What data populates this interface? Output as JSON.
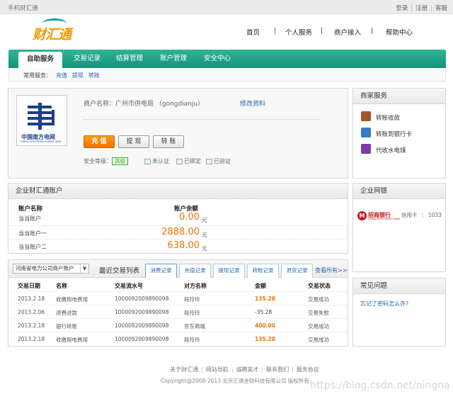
{
  "topbar": {
    "site_name": "手机财汇通",
    "links": [
      "登录",
      "注册",
      "客服"
    ]
  },
  "logo": {
    "text": "财汇通"
  },
  "main_nav": [
    "首页",
    "个人服务",
    "商户接入",
    "帮助中心"
  ],
  "tabs": [
    "自助服务",
    "交易记录",
    "结算管理",
    "账户管理",
    "安全中心"
  ],
  "subnav": {
    "label": "常用服务：",
    "links": [
      "充值",
      "提现",
      "转账"
    ]
  },
  "merchant": {
    "logo_cn": "中国南方电网",
    "logo_en": "CHINA SOUTHERN POWER GRID",
    "info": "商户名称：广州市供电局  （gongdianju）",
    "edit_link": "修改资料",
    "buttons": [
      "充 值",
      "提 现",
      "转 账"
    ],
    "security_label": "安全等级：",
    "security_level": "高级",
    "cert_status": "未认证",
    "bind_status": "已绑定",
    "verify_status": "已验证"
  },
  "accounts": {
    "title": "企业财汇通账户",
    "col_name": "账户名称",
    "col_balance": "账户余额",
    "rows": [
      {
        "name": "当当账户",
        "balance": "0.00",
        "unit": "元"
      },
      {
        "name": "当当账户一",
        "balance": "2888.00",
        "unit": "元"
      },
      {
        "name": "当当账户二",
        "balance": "638.00",
        "unit": "元"
      }
    ]
  },
  "transactions": {
    "company_select": "河南省电力公司商户账户",
    "title": "最近交易列表",
    "tabs": [
      "消费记录",
      "充值记录",
      "提现记录",
      "转账记录",
      "退货记录"
    ],
    "more": "查看所有>>",
    "headers": [
      "交易日期",
      "名称",
      "交易流水号",
      "对方名称",
      "金额",
      "交易状态"
    ],
    "rows": [
      [
        "2013.2.18",
        "收缴用电费用",
        "1000092009890098",
        "段玲玲",
        "135.28",
        "交易成功"
      ],
      [
        "2013.2.06",
        "退费进款",
        "1000092009890098",
        "段玲玲",
        "-35.28",
        "交易失败"
      ],
      [
        "2013.2.18",
        "银行转账",
        "1000092009890098",
        "京东商城",
        "400.00",
        "交易成功"
      ],
      [
        "2013.2.18",
        "收缴用电费用",
        "1000092009890098",
        "段玲玲",
        "135.28",
        "交易成功"
      ]
    ]
  },
  "biz_services": {
    "title": "商家服务",
    "items": [
      "转账收款",
      "转账到银行卡",
      "代收水电煤"
    ]
  },
  "bank": {
    "title": "企业网银",
    "bank_name": "招商银行",
    "bank_en": "CHINA MERCHANTS BANK",
    "card_type": "信用卡",
    "card_tail": "1033"
  },
  "faq": {
    "title": "常见问题",
    "link": "忘记了密码怎么办?"
  },
  "footer": {
    "links": [
      "关于财汇通",
      "网站导航",
      "诚聘英才",
      "联系我们",
      "服务协议"
    ],
    "copyright": "Copyright@2008-2013  北京汇通金财科技有限公司  版权所有",
    "watermark": "https://blog.csdn.net/ningna"
  },
  "colors": {
    "brand_green": "#17927a",
    "accent_orange": "#f07300",
    "link_blue": "#2a64b5"
  }
}
